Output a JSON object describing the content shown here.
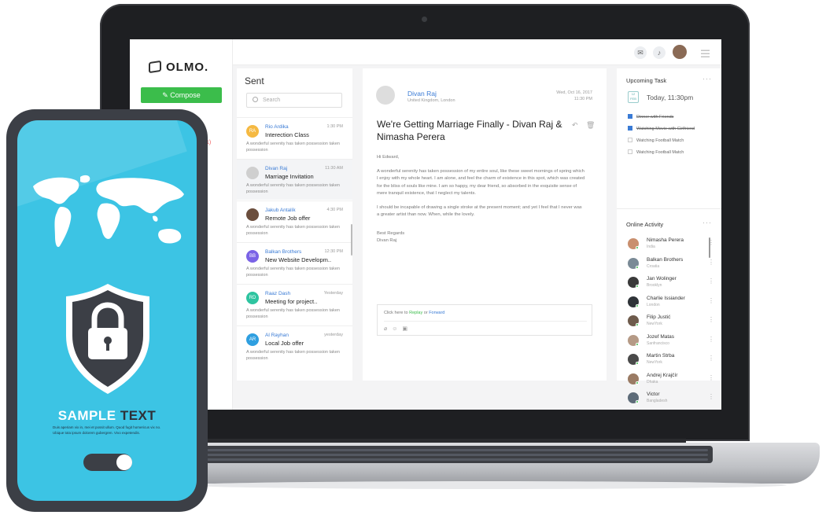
{
  "app": {
    "logo": "OLMO.",
    "compose_label": "Compose",
    "partial_badge": "1)"
  },
  "sent": {
    "title": "Sent",
    "search_placeholder": "Search",
    "items": [
      {
        "initials": "RA",
        "color": "#f5b942",
        "name": "Rio Ardika",
        "time": "1:30 PM",
        "subject": "Interection Class",
        "preview": "A wonderful serenity has taken possession taken possession"
      },
      {
        "initials": "",
        "color": "#cfcfcf",
        "name": "Divan Raj",
        "time": "11:30 AM",
        "subject": "Marriage Invitation",
        "preview": "A wonderful serenity has taken possession taken possession"
      },
      {
        "initials": "",
        "color": "#6b4e3d",
        "name": "Jakub Antalík",
        "time": "4:30 PM",
        "subject": "Remote Job offer",
        "preview": "A wonderful serenity has taken possession taken possession"
      },
      {
        "initials": "BB",
        "color": "#7a63e6",
        "name": "Balkan Brothers",
        "time": "12:30 PM",
        "subject": "New Website Developm..",
        "preview": "A wonderful serenity has taken possession taken possession"
      },
      {
        "initials": "RD",
        "color": "#2ec4a0",
        "name": "Raaz Dash",
        "time": "Yesterday",
        "subject": "Meeting for project..",
        "preview": "A wonderful serenity has taken possession taken possession"
      },
      {
        "initials": "AR",
        "color": "#2f9fe0",
        "name": "Al Rayhan",
        "time": "yesterday",
        "subject": "Local Job offer",
        "preview": "A wonderful serenity has taken possession taken possession"
      }
    ]
  },
  "mail": {
    "from": "Divan Raj",
    "location": "United Kingdom, London",
    "date": "Wed, Oct 16, 2017",
    "time": "11:30 PM",
    "subject": "We're Getting Marriage Finally - Divan Raj & Nimasha Perera",
    "greeting": "Hi Edward,",
    "para1": "A wonderful serenity has taken possession of my entire soul, like these sweet mornings of spring which I enjoy with my whole heart. I am alone, and feel the charm of existence in this spot, which was created for the bliss of souls like mine. I am so happy, my dear friend, so absorbed in the exquisite sense of mere tranquil existence, that I neglect my talents.",
    "para2": "I should be incapable of drawing a single stroke at the present moment; and yet I feel that I never was a greater artist than now. When, while the lovely.",
    "signoff": "Best Regards",
    "signature": "Divan Raj",
    "reply_prefix": "Click here to",
    "reply_link": "Replay",
    "reply_or": "or",
    "forward_link": "Forward",
    "icons": [
      "reply-icon",
      "trash-icon",
      "attach-icon",
      "emoji-icon",
      "image-icon"
    ]
  },
  "tasks": {
    "title": "Upcoming Task",
    "cal_month": "12",
    "cal_day": "FEB",
    "today": "Today, 11:30pm",
    "items": [
      {
        "label": "Dinner with Friends",
        "done": true
      },
      {
        "label": "Watching Movie with Girlfriend",
        "done": true
      },
      {
        "label": "Watching Football Match",
        "done": false
      },
      {
        "label": "Watching Football Match",
        "done": false
      }
    ]
  },
  "activity": {
    "title": "Online Activity",
    "people": [
      {
        "name": "Nimasha Perera",
        "loc": "India",
        "color": "#c98f6e"
      },
      {
        "name": "Balkan Brothers",
        "loc": "Croatia",
        "color": "#7a8a96"
      },
      {
        "name": "Jan Wolinger",
        "loc": "Brooklyn",
        "color": "#3a3a3a"
      },
      {
        "name": "Charlie Issiander",
        "loc": "London",
        "color": "#2f3338"
      },
      {
        "name": "Filip Justić",
        "loc": "NewYork",
        "color": "#6e5b4c"
      },
      {
        "name": "Jozef Matas",
        "loc": "Sanfrancisco",
        "color": "#b59a86"
      },
      {
        "name": "Martin Strba",
        "loc": "NewYork",
        "color": "#4a4a4a"
      },
      {
        "name": "Andrej Krajčír",
        "loc": "Dhaka",
        "color": "#9a7b64"
      },
      {
        "name": "Victor",
        "loc": "Bangladesh",
        "color": "#5d6b78"
      }
    ]
  },
  "phone": {
    "title_light": "SAMPLE",
    "title_dark": "TEXT",
    "small_text": "Duis aperiam vix in, mei et possit ullum. Quod fugit homericus vix no. Ubique tota ipsum dolorem gubergren. Vivo expetendis."
  }
}
